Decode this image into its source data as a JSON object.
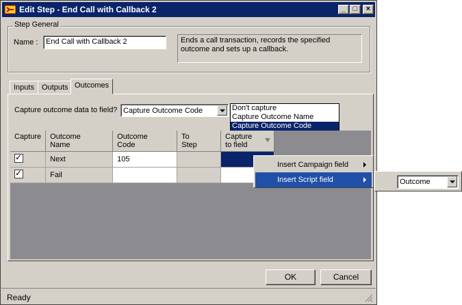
{
  "window": {
    "title": "Edit Step - End Call with Callback 2",
    "controls": {
      "minimize": "_",
      "maximize": "□",
      "close": "×"
    }
  },
  "step_general": {
    "group_label": "Step General",
    "name_label": "Name :",
    "name_value": "End Call with Callback 2",
    "description": "Ends a call transaction, records the specified outcome and sets up a callback."
  },
  "tabs": [
    {
      "label": "Inputs",
      "active": false
    },
    {
      "label": "Outputs",
      "active": false
    },
    {
      "label": "Outcomes",
      "active": true
    }
  ],
  "outcomes": {
    "capture_label": "Capture outcome data to field?",
    "capture_selected": "Capture Outcome Code",
    "capture_options": [
      "Don't capture",
      "Capture Outcome Name",
      "Capture Outcome Code"
    ],
    "columns": [
      "Capture",
      "Outcome Name",
      "Outcome Code",
      "To Step",
      "Capture to field"
    ],
    "rows": [
      {
        "capture": true,
        "name": "Next",
        "code": "105",
        "to_step": "",
        "capture_field": ""
      },
      {
        "capture": true,
        "name": "Fail",
        "code": "",
        "to_step": "",
        "capture_field": ""
      }
    ]
  },
  "context_menu": {
    "items": [
      {
        "label": "Insert Campaign field",
        "highlighted": false
      },
      {
        "label": "Insert Script field",
        "highlighted": true
      }
    ],
    "submenu_combo_value": "Outcome"
  },
  "buttons": {
    "ok": "OK",
    "cancel": "Cancel"
  },
  "status": {
    "text": "Ready"
  },
  "colors": {
    "titlebar": "#0a246a",
    "selection": "#0a246a",
    "face": "#d4d0c8",
    "grid_bg": "#8c8b8f"
  }
}
